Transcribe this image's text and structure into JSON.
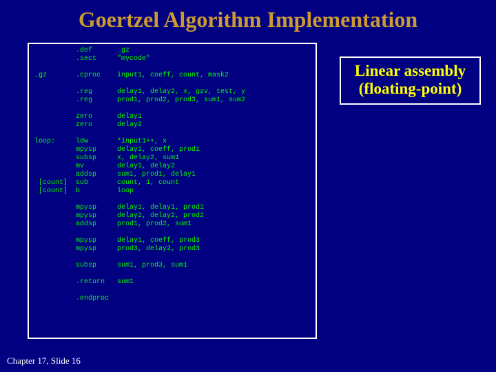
{
  "title": "Goertzel Algorithm Implementation",
  "callout": {
    "line1": "Linear assembly",
    "line2": "(floating-point)"
  },
  "footer": "Chapter 17, Slide 16",
  "code": "          .def      _gz\n          .sect     \"mycode\"\n\n_gz       .cproc    input1, coeff, count, mask2\n\n          .reg      delay1, delay2, x, gzv, test, y\n          .reg      prod1, prod2, prod3, sum1, sum2\n\n          zero      delay1\n          zero      delay2\n\nloop:     ldw       *input1++, x\n          mpysp     delay1, coeff, prod1\n          subsp     x, delay2, sum1\n          mv        delay1, delay2\n          addsp     sum1, prod1, delay1\n [count]  sub       count, 1, count\n [count]  b         loop\n\n          mpysp     delay1, delay1, prod1\n          mpysp     delay2, delay2, prod2\n          addsp     prod1, prod2, sum1\n\n          mpysp     delay1, coeff, prod3\n          mpysp     prod3, delay2, prod3\n\n          subsp     sum1, prod3, sum1\n\n          .return   sum1\n\n          .endproc"
}
